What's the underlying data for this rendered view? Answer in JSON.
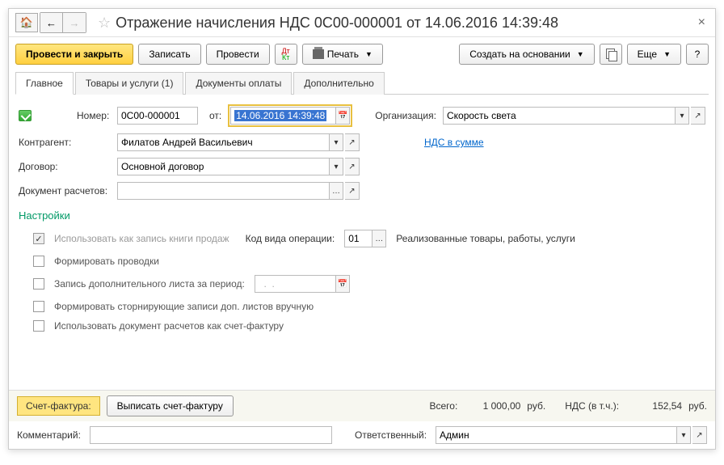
{
  "title": "Отражение начисления НДС 0С00-000001 от 14.06.2016 14:39:48",
  "toolbar": {
    "submit": "Провести и закрыть",
    "save": "Записать",
    "post": "Провести",
    "print": "Печать",
    "createBased": "Создать на основании",
    "more": "Еще",
    "help": "?"
  },
  "tabs": {
    "main": "Главное",
    "goods": "Товары и услуги (1)",
    "payments": "Документы оплаты",
    "extra": "Дополнительно"
  },
  "form": {
    "numberLabel": "Номер:",
    "number": "0С00-000001",
    "dateLabel": "от:",
    "date": "14.06.2016 14:39:48",
    "orgLabel": "Организация:",
    "org": "Скорость света",
    "counterpartyLabel": "Контрагент:",
    "counterparty": "Филатов Андрей Васильевич",
    "vatLink": "НДС в сумме",
    "contractLabel": "Договор:",
    "contract": "Основной договор",
    "docLabel": "Документ расчетов:",
    "doc": ""
  },
  "settings": {
    "title": "Настройки",
    "useAsSalesBook": "Использовать как запись книги продаж",
    "opCodeLabel": "Код вида операции:",
    "opCode": "01",
    "opCodeDesc": "Реализованные товары, работы, услуги",
    "makeEntries": "Формировать проводки",
    "addSheet": "Запись дополнительного листа за период:",
    "addSheetDate": "  .  .    ",
    "storno": "Формировать сторнирующие записи доп. листов вручную",
    "useDocAsInvoice": "Использовать документ расчетов как счет-фактуру"
  },
  "footer": {
    "invoiceLabel": "Счет-фактура:",
    "issueInvoice": "Выписать счет-фактуру",
    "totalLabel": "Всего:",
    "total": "1 000,00",
    "currency": "руб.",
    "vatLabel": "НДС (в т.ч.):",
    "vat": "152,54",
    "commentLabel": "Комментарий:",
    "comment": "",
    "responsibleLabel": "Ответственный:",
    "responsible": "Админ"
  }
}
